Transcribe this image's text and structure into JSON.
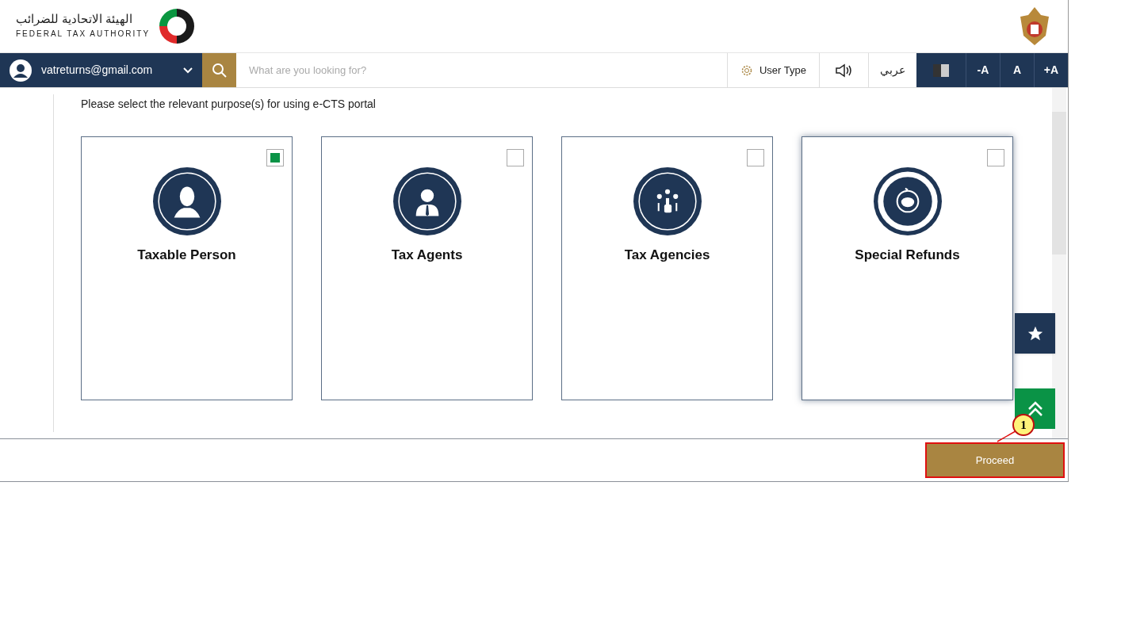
{
  "header": {
    "logo_arabic": "الهيئة الاتحادية للضرائب",
    "logo_english": "FEDERAL TAX AUTHORITY"
  },
  "nav": {
    "user": "vatreturns@gmail.com",
    "search": {
      "placeholder": "What are you looking for?"
    },
    "user_type": "User Type",
    "language": "عربي",
    "font_buttons": [
      "-A",
      "A",
      "+A"
    ]
  },
  "prompt": "Please select the relevant purpose(s) for using e-CTS portal",
  "options": [
    {
      "label": "Taxable Person",
      "checked": true,
      "highlighted": false
    },
    {
      "label": "Tax Agents",
      "checked": false,
      "highlighted": false
    },
    {
      "label": "Tax Agencies",
      "checked": false,
      "highlighted": false
    },
    {
      "label": "Special Refunds",
      "checked": false,
      "highlighted": true
    }
  ],
  "footer": {
    "button": "Proceed"
  },
  "callout": {
    "number": "1"
  }
}
